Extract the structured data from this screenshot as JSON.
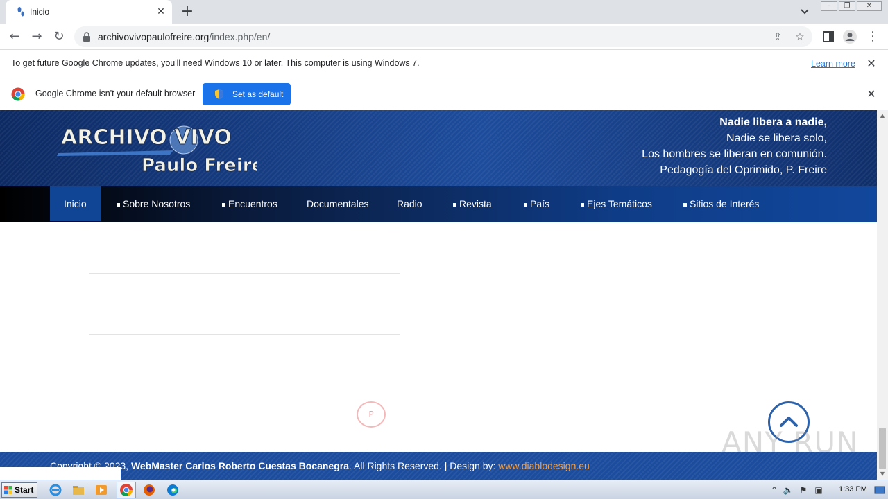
{
  "browser": {
    "tab_title": "Inicio",
    "url_domain": "archivovivopaulofreire.org",
    "url_path": "/index.php/en/"
  },
  "infobar_update": {
    "message": "To get future Google Chrome updates, you'll need Windows 10 or later. This computer is using Windows 7.",
    "link": "Learn more"
  },
  "infobar_default": {
    "message": "Google Chrome isn't your default browser",
    "button": "Set as default"
  },
  "site": {
    "logo_line1": "ARCHIVO VIVO",
    "logo_line2": "Paulo Freire",
    "quote": {
      "line1": "Nadie libera a nadie,",
      "line2": "Nadie se libera solo,",
      "line3": "Los hombres se liberan en comunión.",
      "line4": "Pedagogía del Oprimido,  P. Freire"
    },
    "nav": [
      {
        "label": "Inicio"
      },
      {
        "label": "Sobre Nosotros"
      },
      {
        "label": "Encuentros"
      },
      {
        "label": "Documentales"
      },
      {
        "label": "Radio"
      },
      {
        "label": "Revista"
      },
      {
        "label": "País"
      },
      {
        "label": "Ejes Temáticos"
      },
      {
        "label": "Sitios de Interés"
      }
    ],
    "pin_label": "P",
    "watermark": "ANY RUN",
    "footer": {
      "copyright": "Copyright © 2023, ",
      "webmaster": "WebMaster Carlos Roberto Cuestas Bocanegra",
      "rights": ". All Rights Reserved. |  Design by: ",
      "designer": "www.diablodesign.eu"
    }
  },
  "taskbar": {
    "start": "Start",
    "clock": "1:33 PM"
  },
  "colors": {
    "chrome_blue": "#1a73e8",
    "header_blue": "#1d4c9c",
    "footer_blue": "#1b4c9d",
    "designer_orange": "#f0a04b"
  }
}
